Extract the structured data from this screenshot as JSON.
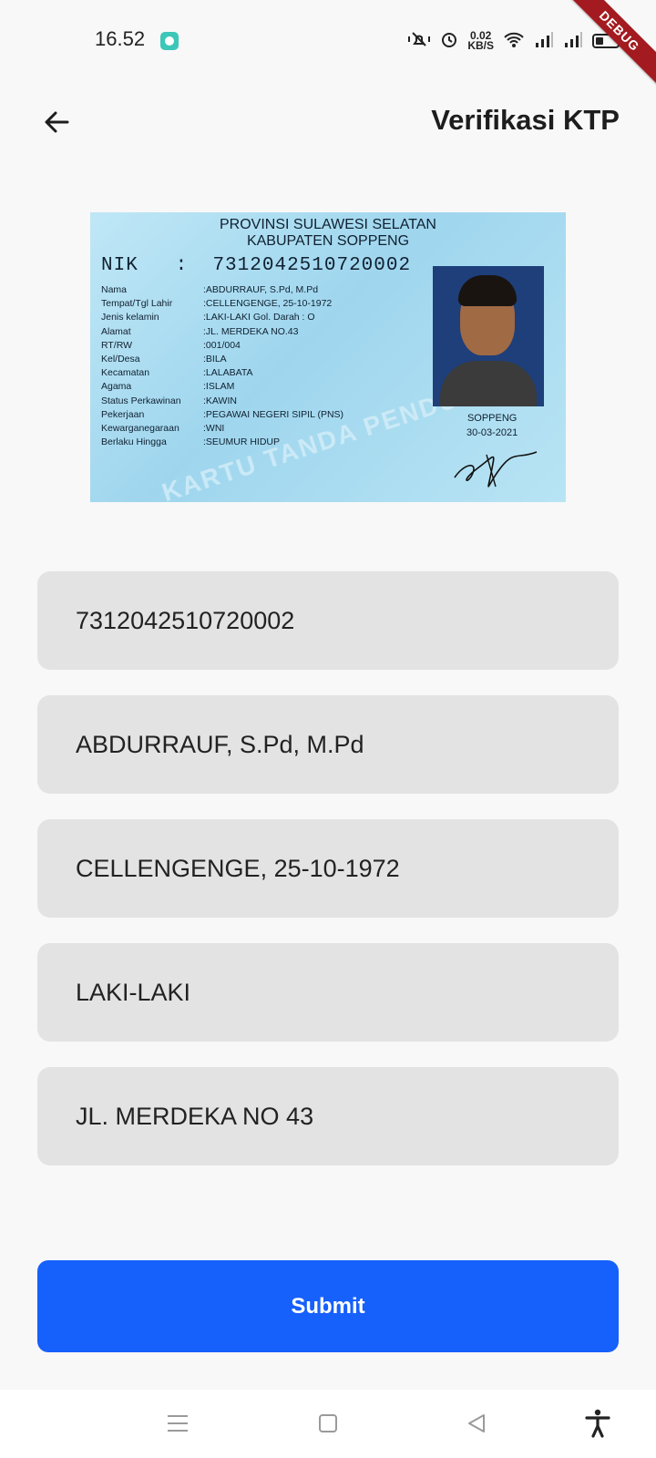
{
  "status_bar": {
    "time": "16.52",
    "network_rate_value": "0.02",
    "network_rate_unit": "KB/S",
    "icons": [
      "app-notification-icon",
      "mute-vibrate-icon",
      "alarm-icon",
      "wifi-icon",
      "signal-icon",
      "signal-icon",
      "battery-icon"
    ]
  },
  "debug_banner": "DEBUG",
  "app_bar": {
    "back_icon": "arrow-left-icon",
    "title": "Verifikasi KTP"
  },
  "ktp_image": {
    "province": "PROVINSI SULAWESI SELATAN",
    "regency": "KABUPATEN SOPPENG",
    "nik_label": "NIK",
    "nik_value": "7312042510720002",
    "fields": [
      {
        "label": "Nama",
        "value": "ABDURRAUF, S.Pd, M.Pd"
      },
      {
        "label": "Tempat/Tgl Lahir",
        "value": "CELLENGENGE, 25-10-1972"
      },
      {
        "label": "Jenis kelamin",
        "value": "LAKI-LAKI      Gol. Darah  : O"
      },
      {
        "label": "Alamat",
        "value": "JL. MERDEKA NO.43"
      },
      {
        "label": "      RT/RW",
        "value": "001/004"
      },
      {
        "label": "      Kel/Desa",
        "value": "BILA"
      },
      {
        "label": "      Kecamatan",
        "value": "LALABATA"
      },
      {
        "label": "Agama",
        "value": "ISLAM"
      },
      {
        "label": "Status Perkawinan",
        "value": "KAWIN"
      },
      {
        "label": "Pekerjaan",
        "value": "PEGAWAI NEGERI SIPIL (PNS)"
      },
      {
        "label": "Kewarganegaraan",
        "value": "WNI"
      },
      {
        "label": "Berlaku Hingga",
        "value": "SEUMUR HIDUP"
      }
    ],
    "issue_place": "SOPPENG",
    "issue_date": "30-03-2021",
    "watermark": "KARTU TANDA PENDUDUK"
  },
  "form": {
    "nik": "7312042510720002",
    "name": "ABDURRAUF, S.Pd, M.Pd",
    "birth": "CELLENGENGE, 25-10-1972",
    "gender": "LAKI-LAKI",
    "address": "JL. MERDEKA NO 43"
  },
  "submit_label": "Submit",
  "colors": {
    "accent": "#1660fb",
    "field_bg": "#e3e3e3",
    "page_bg": "#f8f8f8",
    "debug": "#a31b20"
  },
  "nav_bar": {
    "icons": [
      "menu-icon",
      "home-square-icon",
      "back-triangle-icon",
      "accessibility-icon"
    ]
  }
}
